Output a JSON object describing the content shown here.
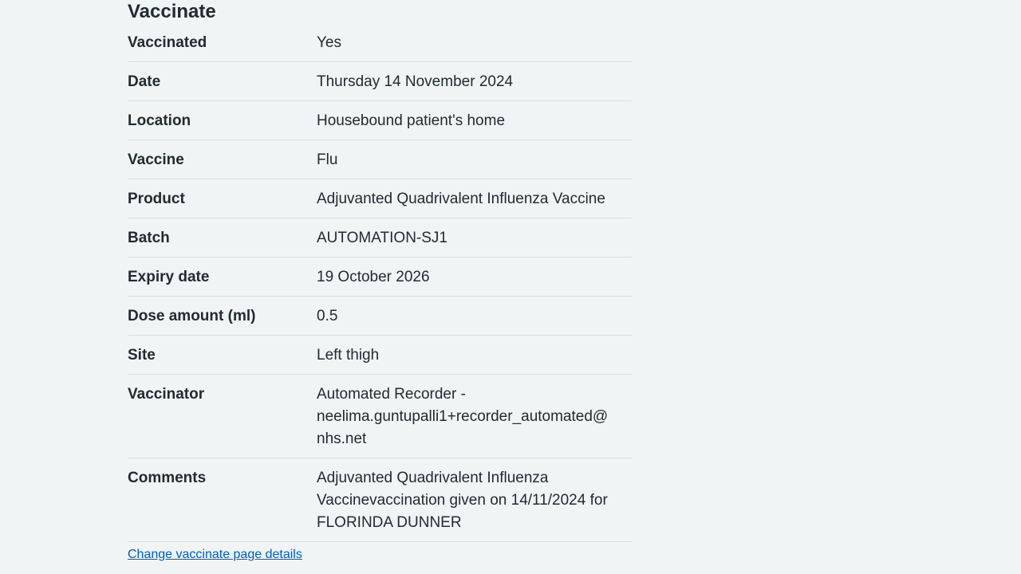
{
  "section": {
    "title": "Vaccinate"
  },
  "rows": [
    {
      "key": "Vaccinated",
      "value": "Yes"
    },
    {
      "key": "Date",
      "value": "Thursday 14 November 2024"
    },
    {
      "key": "Location",
      "value": "Housebound patient's home"
    },
    {
      "key": "Vaccine",
      "value": "Flu"
    },
    {
      "key": "Product",
      "value": "Adjuvanted Quadrivalent Influenza Vaccine"
    },
    {
      "key": "Batch",
      "value": "AUTOMATION-SJ1"
    },
    {
      "key": "Expiry date",
      "value": "19 October 2026"
    },
    {
      "key": "Dose amount (ml)",
      "value": "0.5"
    },
    {
      "key": "Site",
      "value": "Left thigh"
    },
    {
      "key": "Vaccinator",
      "value": "Automated Recorder - neelima.guntupalli1+recorder_automated@nhs.net"
    },
    {
      "key": "Comments",
      "value": "Adjuvanted Quadrivalent Influenza Vaccinevaccination given on 14/11/2024 for FLORINDA DUNNER"
    }
  ],
  "links": {
    "change": "Change vaccinate page details"
  },
  "colors": {
    "background": "#f0f4f5",
    "text": "#212b32",
    "link": "#005eb8",
    "divider": "#d8dde0"
  }
}
